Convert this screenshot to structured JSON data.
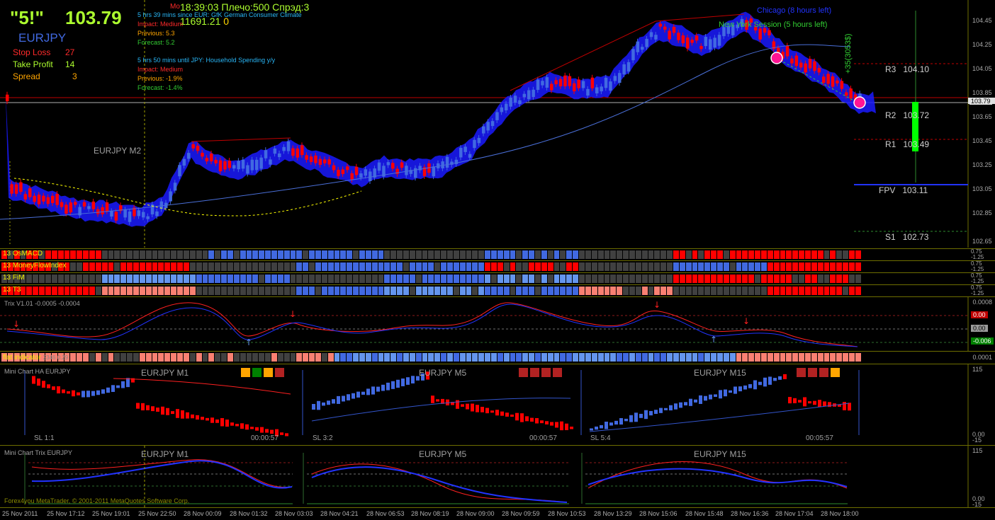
{
  "header": {
    "badge": "\"5!\"",
    "price": "103.79",
    "symbol": "EURJPY",
    "stop_loss_label": "Stop Loss",
    "stop_loss_value": "27",
    "take_profit_label": "Take Profit",
    "take_profit_value": "14",
    "spread_label": "Spread",
    "spread_value": "3",
    "clock": "18:39:03 Плечо:500 Спрэд:3",
    "balance": "11691.21",
    "balance_extra": "0",
    "mo_prefix": "Mo",
    "chart_name": "EURJPY M2"
  },
  "news": [
    {
      "title": "5 hrs 39 mins since EUR: GfK German Consumer Climate",
      "impact": "Impact: Medium",
      "previous": "Previous: 5.3",
      "forecast": "Forecast: 5.2"
    },
    {
      "title": "5 hrs 50 mins until JPY: Household Spending y/y",
      "impact": "Impact: Medium",
      "previous": "Previous: -1.9%",
      "forecast": "Forecast: -1.4%"
    }
  ],
  "sessions": {
    "chicago": "Chicago (8 hours left)",
    "newyork": "New York Session (5 hours left)"
  },
  "pivots": {
    "r3": {
      "label": "R3",
      "value": "104.10"
    },
    "r2": {
      "label": "R2",
      "value": "103.72"
    },
    "r1": {
      "label": "R1",
      "value": "103.49"
    },
    "fpv": {
      "label": "FPV",
      "value": "103.11"
    },
    "s1": {
      "label": "S1",
      "value": "102.73"
    }
  },
  "profit_label": "+35(3053$)",
  "price_scale": [
    "104.45",
    "104.25",
    "104.05",
    "103.85",
    "103.79",
    "103.65",
    "103.45",
    "103.25",
    "103.05",
    "102.85",
    "102.65"
  ],
  "current_price_tag": "103.79",
  "heat_bars": [
    {
      "label": "13 OsMACD",
      "scale": [
        "0.75",
        "-1.25"
      ]
    },
    {
      "label": "13 MoneyFlowIndex",
      "scale": [
        "0.75",
        "-1.25"
      ]
    },
    {
      "label": "13 FiM",
      "scale": [
        "0.75",
        "-1.25"
      ]
    },
    {
      "label": "13 T3",
      "scale": [
        "0.75",
        "-1.25"
      ]
    }
  ],
  "trix": {
    "label": "Trix V1.01 -0.0005 -0.0004",
    "scale": [
      "0.0008",
      "0.00",
      "0.00",
      "-0.006"
    ]
  },
  "flat": {
    "label": "flat indicator",
    "label_extra": "2346 0.29",
    "scale": "0.0001"
  },
  "mini_ha": {
    "label": "Mini Chart HA EURJPY",
    "scale": [
      "115",
      "0.00",
      "-15"
    ],
    "charts": [
      {
        "title": "EURJPY M1",
        "sl": "SL 1:1",
        "timer": "00:00:57"
      },
      {
        "title": "EURJPY M5",
        "sl": "SL 3:2",
        "timer": "00:00:57"
      },
      {
        "title": "EURJPY M15",
        "sl": "SL 5:4",
        "timer": "00:05:57"
      }
    ]
  },
  "mini_trix": {
    "label": "Mini Chart Trix EURJPY",
    "scale": [
      "115",
      "0.00",
      "-15"
    ],
    "charts": [
      {
        "title": "EURJPY M1"
      },
      {
        "title": "EURJPY M5"
      },
      {
        "title": "EURJPY M15"
      }
    ]
  },
  "copyright": "Forex4you MetaTrader, © 2001-2011 MetaQuotes Software Corp.",
  "time_axis": [
    "25 Nov 2011",
    "25 Nov 17:12",
    "25 Nov 19:01",
    "25 Nov 22:50",
    "28 Nov 00:09",
    "28 Nov 01:32",
    "28 Nov 03:03",
    "28 Nov 04:21",
    "28 Nov 06:53",
    "28 Nov 08:19",
    "28 Nov 09:00",
    "28 Nov 09:59",
    "28 Nov 10:53",
    "28 Nov 13:29",
    "28 Nov 15:06",
    "28 Nov 15:48",
    "28 Nov 16:36",
    "28 Nov 17:04",
    "28 Nov 18:00"
  ],
  "colors": {
    "bull": "#4169e1",
    "bear": "#ff0000",
    "neutral": "#404040",
    "light_bull": "#6495ed",
    "light_bear": "#fa8072",
    "grid": "#6e6e00",
    "accent": "#adff2f"
  }
}
